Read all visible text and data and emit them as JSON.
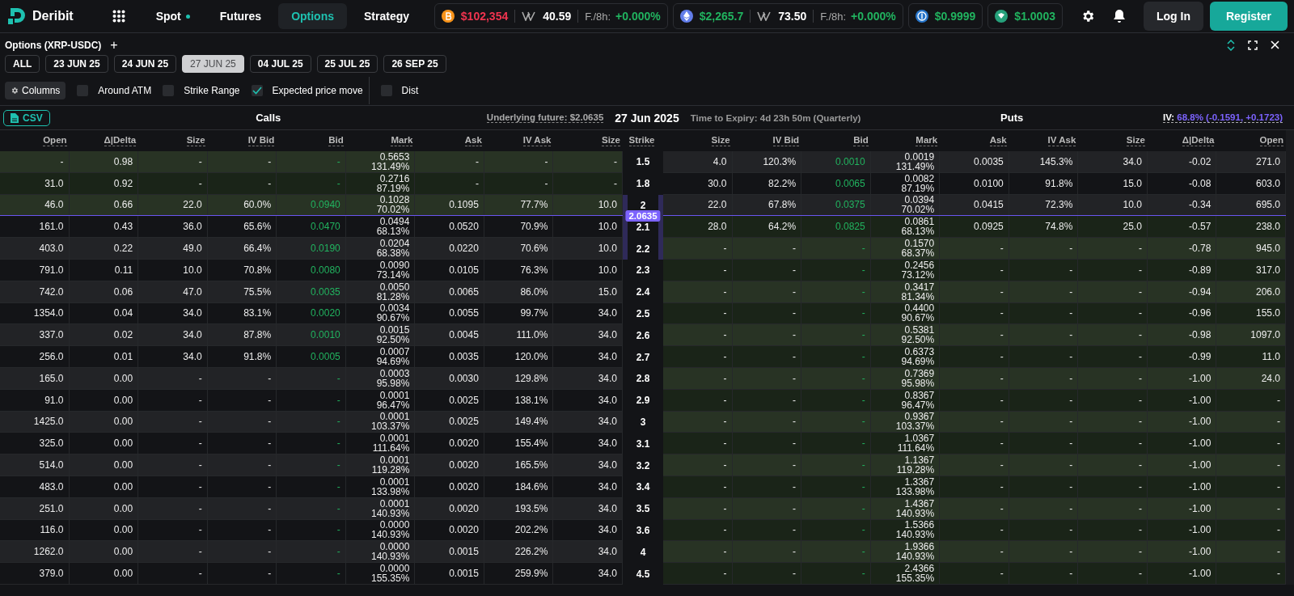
{
  "nav": {
    "logo": "Deribit",
    "items": [
      {
        "label": "Spot",
        "selected": false,
        "live": true
      },
      {
        "label": "Futures",
        "selected": false,
        "live": false
      },
      {
        "label": "Options",
        "selected": true,
        "live": false
      },
      {
        "label": "Strategy",
        "selected": false,
        "live": false
      }
    ],
    "tickers": [
      {
        "price": "$102,354",
        "falling": true,
        "index": "40.59",
        "funding_label": "F./8h:",
        "funding": "+0.000%"
      },
      {
        "price": "$2,265.7",
        "falling": false,
        "index": "73.50",
        "funding_label": "F./8h:",
        "funding": "+0.000%"
      },
      {
        "price": "$0.9999",
        "falling": false
      },
      {
        "price": "$1.0003",
        "falling": false
      }
    ],
    "login": "Log In",
    "register": "Register"
  },
  "panel": {
    "title": "Options (XRP-USDC)",
    "add": "+",
    "expiries": [
      {
        "label": "ALL",
        "selected": false
      },
      {
        "label": "23 JUN 25",
        "selected": false
      },
      {
        "label": "24 JUN 25",
        "selected": false
      },
      {
        "label": "27 JUN 25",
        "selected": true
      },
      {
        "label": "04 JUL 25",
        "selected": false
      },
      {
        "label": "25 JUL 25",
        "selected": false
      },
      {
        "label": "26 SEP 25",
        "selected": false
      }
    ],
    "columns_button": "Columns",
    "filter_groups": [
      {
        "items": [
          {
            "label": "Around ATM",
            "checked": false
          },
          {
            "label": "Strike Range",
            "checked": false
          },
          {
            "label": "Expected price move",
            "checked": true
          }
        ]
      },
      {
        "items": [
          {
            "label": "Dist",
            "checked": false
          }
        ]
      }
    ]
  },
  "chain": {
    "csv": "CSV",
    "calls_title": "Calls",
    "underlying": "Underlying future: $2.0635",
    "date": "27 Jun 2025",
    "expiry": "Time to Expiry: 4d 23h 50m (Quarterly)",
    "puts_title": "Puts",
    "iv_label": "IV:",
    "iv_value": "68.8% (-0.1591, +0.1723)",
    "call_columns": [
      "Open",
      "Δ|Delta",
      "Size",
      "IV Bid",
      "Bid",
      "Mark",
      "Ask",
      "IV Ask",
      "Size"
    ],
    "strike_column": "Strike",
    "put_columns": [
      "Size",
      "IV Bid",
      "Bid",
      "Mark",
      "Ask",
      "IV Ask",
      "Size",
      "Δ|Delta",
      "Open"
    ],
    "rows": [
      {
        "strike": "1.5",
        "in_move_range": false,
        "call": {
          "itm": true,
          "cells": [
            "-",
            "0.98",
            "-",
            "-",
            "-",
            "0.5653",
            "131.49%",
            "-",
            "-",
            "-"
          ]
        },
        "put": {
          "itm": false,
          "cells": [
            "4.0",
            "120.3%",
            "0.0010",
            "0.0019",
            "131.49%",
            "0.0035",
            "145.3%",
            "34.0",
            "-0.02",
            "271.0"
          ]
        }
      },
      {
        "strike": "1.8",
        "in_move_range": false,
        "call": {
          "itm": true,
          "cells": [
            "31.0",
            "0.92",
            "-",
            "-",
            "-",
            "0.2716",
            "87.19%",
            "-",
            "-",
            "-"
          ]
        },
        "put": {
          "itm": false,
          "cells": [
            "30.0",
            "82.2%",
            "0.0065",
            "0.0082",
            "87.19%",
            "0.0100",
            "91.8%",
            "15.0",
            "-0.08",
            "603.0"
          ]
        }
      },
      {
        "strike": "2",
        "in_move_range": true,
        "price_line": "2.0635",
        "call": {
          "itm": true,
          "cells": [
            "46.0",
            "0.66",
            "22.0",
            "60.0%",
            "0.0940",
            "0.1028",
            "70.02%",
            "0.1095",
            "77.7%",
            "10.0"
          ]
        },
        "put": {
          "itm": false,
          "cells": [
            "22.0",
            "67.8%",
            "0.0375",
            "0.0394",
            "70.02%",
            "0.0415",
            "72.3%",
            "10.0",
            "-0.34",
            "695.0"
          ]
        }
      },
      {
        "strike": "2.1",
        "in_move_range": true,
        "call": {
          "itm": false,
          "cells": [
            "161.0",
            "0.43",
            "36.0",
            "65.6%",
            "0.0470",
            "0.0494",
            "68.13%",
            "0.0520",
            "70.9%",
            "10.0"
          ]
        },
        "put": {
          "itm": true,
          "cells": [
            "28.0",
            "64.2%",
            "0.0825",
            "0.0861",
            "68.13%",
            "0.0925",
            "74.8%",
            "25.0",
            "-0.57",
            "238.0"
          ]
        }
      },
      {
        "strike": "2.2",
        "in_move_range": true,
        "call": {
          "itm": false,
          "cells": [
            "403.0",
            "0.22",
            "49.0",
            "66.4%",
            "0.0190",
            "0.0204",
            "68.38%",
            "0.0220",
            "70.6%",
            "10.0"
          ]
        },
        "put": {
          "itm": true,
          "cells": [
            "-",
            "-",
            "-",
            "0.1570",
            "68.37%",
            "-",
            "-",
            "-",
            "-0.78",
            "945.0"
          ]
        }
      },
      {
        "strike": "2.3",
        "in_move_range": false,
        "call": {
          "itm": false,
          "cells": [
            "791.0",
            "0.11",
            "10.0",
            "70.8%",
            "0.0080",
            "0.0090",
            "73.14%",
            "0.0105",
            "76.3%",
            "10.0"
          ]
        },
        "put": {
          "itm": true,
          "cells": [
            "-",
            "-",
            "-",
            "0.2456",
            "73.12%",
            "-",
            "-",
            "-",
            "-0.89",
            "317.0"
          ]
        }
      },
      {
        "strike": "2.4",
        "in_move_range": false,
        "call": {
          "itm": false,
          "cells": [
            "742.0",
            "0.06",
            "47.0",
            "75.5%",
            "0.0035",
            "0.0050",
            "81.28%",
            "0.0065",
            "86.0%",
            "15.0"
          ]
        },
        "put": {
          "itm": true,
          "cells": [
            "-",
            "-",
            "-",
            "0.3417",
            "81.34%",
            "-",
            "-",
            "-",
            "-0.94",
            "206.0"
          ]
        }
      },
      {
        "strike": "2.5",
        "in_move_range": false,
        "call": {
          "itm": false,
          "cells": [
            "1354.0",
            "0.04",
            "34.0",
            "83.1%",
            "0.0020",
            "0.0034",
            "90.67%",
            "0.0055",
            "99.7%",
            "34.0"
          ]
        },
        "put": {
          "itm": true,
          "cells": [
            "-",
            "-",
            "-",
            "0.4400",
            "90.67%",
            "-",
            "-",
            "-",
            "-0.96",
            "155.0"
          ]
        }
      },
      {
        "strike": "2.6",
        "in_move_range": false,
        "call": {
          "itm": false,
          "cells": [
            "337.0",
            "0.02",
            "34.0",
            "87.8%",
            "0.0010",
            "0.0015",
            "92.50%",
            "0.0045",
            "111.0%",
            "34.0"
          ]
        },
        "put": {
          "itm": true,
          "cells": [
            "-",
            "-",
            "-",
            "0.5381",
            "92.50%",
            "-",
            "-",
            "-",
            "-0.98",
            "1097.0"
          ]
        }
      },
      {
        "strike": "2.7",
        "in_move_range": false,
        "call": {
          "itm": false,
          "cells": [
            "256.0",
            "0.01",
            "34.0",
            "91.8%",
            "0.0005",
            "0.0007",
            "94.69%",
            "0.0035",
            "120.0%",
            "34.0"
          ]
        },
        "put": {
          "itm": true,
          "cells": [
            "-",
            "-",
            "-",
            "0.6373",
            "94.69%",
            "-",
            "-",
            "-",
            "-0.99",
            "11.0"
          ]
        }
      },
      {
        "strike": "2.8",
        "in_move_range": false,
        "call": {
          "itm": false,
          "cells": [
            "165.0",
            "0.00",
            "-",
            "-",
            "-",
            "0.0003",
            "95.98%",
            "0.0030",
            "129.8%",
            "34.0"
          ]
        },
        "put": {
          "itm": true,
          "cells": [
            "-",
            "-",
            "-",
            "0.7369",
            "95.98%",
            "-",
            "-",
            "-",
            "-1.00",
            "24.0"
          ]
        }
      },
      {
        "strike": "2.9",
        "in_move_range": false,
        "call": {
          "itm": false,
          "cells": [
            "91.0",
            "0.00",
            "-",
            "-",
            "-",
            "0.0001",
            "96.47%",
            "0.0025",
            "138.1%",
            "34.0"
          ]
        },
        "put": {
          "itm": true,
          "cells": [
            "-",
            "-",
            "-",
            "0.8367",
            "96.47%",
            "-",
            "-",
            "-",
            "-1.00",
            "-"
          ]
        }
      },
      {
        "strike": "3",
        "in_move_range": false,
        "call": {
          "itm": false,
          "cells": [
            "1425.0",
            "0.00",
            "-",
            "-",
            "-",
            "0.0001",
            "103.37%",
            "0.0025",
            "149.4%",
            "34.0"
          ]
        },
        "put": {
          "itm": true,
          "cells": [
            "-",
            "-",
            "-",
            "0.9367",
            "103.37%",
            "-",
            "-",
            "-",
            "-1.00",
            "-"
          ]
        }
      },
      {
        "strike": "3.1",
        "in_move_range": false,
        "call": {
          "itm": false,
          "cells": [
            "325.0",
            "0.00",
            "-",
            "-",
            "-",
            "0.0001",
            "111.64%",
            "0.0020",
            "155.4%",
            "34.0"
          ]
        },
        "put": {
          "itm": true,
          "cells": [
            "-",
            "-",
            "-",
            "1.0367",
            "111.64%",
            "-",
            "-",
            "-",
            "-1.00",
            "-"
          ]
        }
      },
      {
        "strike": "3.2",
        "in_move_range": false,
        "call": {
          "itm": false,
          "cells": [
            "514.0",
            "0.00",
            "-",
            "-",
            "-",
            "0.0001",
            "119.28%",
            "0.0020",
            "165.5%",
            "34.0"
          ]
        },
        "put": {
          "itm": true,
          "cells": [
            "-",
            "-",
            "-",
            "1.1367",
            "119.28%",
            "-",
            "-",
            "-",
            "-1.00",
            "-"
          ]
        }
      },
      {
        "strike": "3.4",
        "in_move_range": false,
        "call": {
          "itm": false,
          "cells": [
            "483.0",
            "0.00",
            "-",
            "-",
            "-",
            "0.0001",
            "133.98%",
            "0.0020",
            "184.6%",
            "34.0"
          ]
        },
        "put": {
          "itm": true,
          "cells": [
            "-",
            "-",
            "-",
            "1.3367",
            "133.98%",
            "-",
            "-",
            "-",
            "-1.00",
            "-"
          ]
        }
      },
      {
        "strike": "3.5",
        "in_move_range": false,
        "call": {
          "itm": false,
          "cells": [
            "251.0",
            "0.00",
            "-",
            "-",
            "-",
            "0.0001",
            "140.93%",
            "0.0020",
            "193.5%",
            "34.0"
          ]
        },
        "put": {
          "itm": true,
          "cells": [
            "-",
            "-",
            "-",
            "1.4367",
            "140.93%",
            "-",
            "-",
            "-",
            "-1.00",
            "-"
          ]
        }
      },
      {
        "strike": "3.6",
        "in_move_range": false,
        "call": {
          "itm": false,
          "cells": [
            "116.0",
            "0.00",
            "-",
            "-",
            "-",
            "0.0000",
            "140.93%",
            "0.0020",
            "202.2%",
            "34.0"
          ]
        },
        "put": {
          "itm": true,
          "cells": [
            "-",
            "-",
            "-",
            "1.5366",
            "140.93%",
            "-",
            "-",
            "-",
            "-1.00",
            "-"
          ]
        }
      },
      {
        "strike": "4",
        "in_move_range": false,
        "call": {
          "itm": false,
          "cells": [
            "1262.0",
            "0.00",
            "-",
            "-",
            "-",
            "0.0000",
            "140.93%",
            "0.0015",
            "226.2%",
            "34.0"
          ]
        },
        "put": {
          "itm": true,
          "cells": [
            "-",
            "-",
            "-",
            "1.9366",
            "140.93%",
            "-",
            "-",
            "-",
            "-1.00",
            "-"
          ]
        }
      },
      {
        "strike": "4.5",
        "in_move_range": false,
        "call": {
          "itm": false,
          "cells": [
            "379.0",
            "0.00",
            "-",
            "-",
            "-",
            "0.0000",
            "155.35%",
            "0.0015",
            "259.9%",
            "34.0"
          ]
        },
        "put": {
          "itm": true,
          "cells": [
            "-",
            "-",
            "-",
            "2.4366",
            "155.35%",
            "-",
            "-",
            "-",
            "-1.00",
            "-"
          ]
        }
      }
    ]
  }
}
